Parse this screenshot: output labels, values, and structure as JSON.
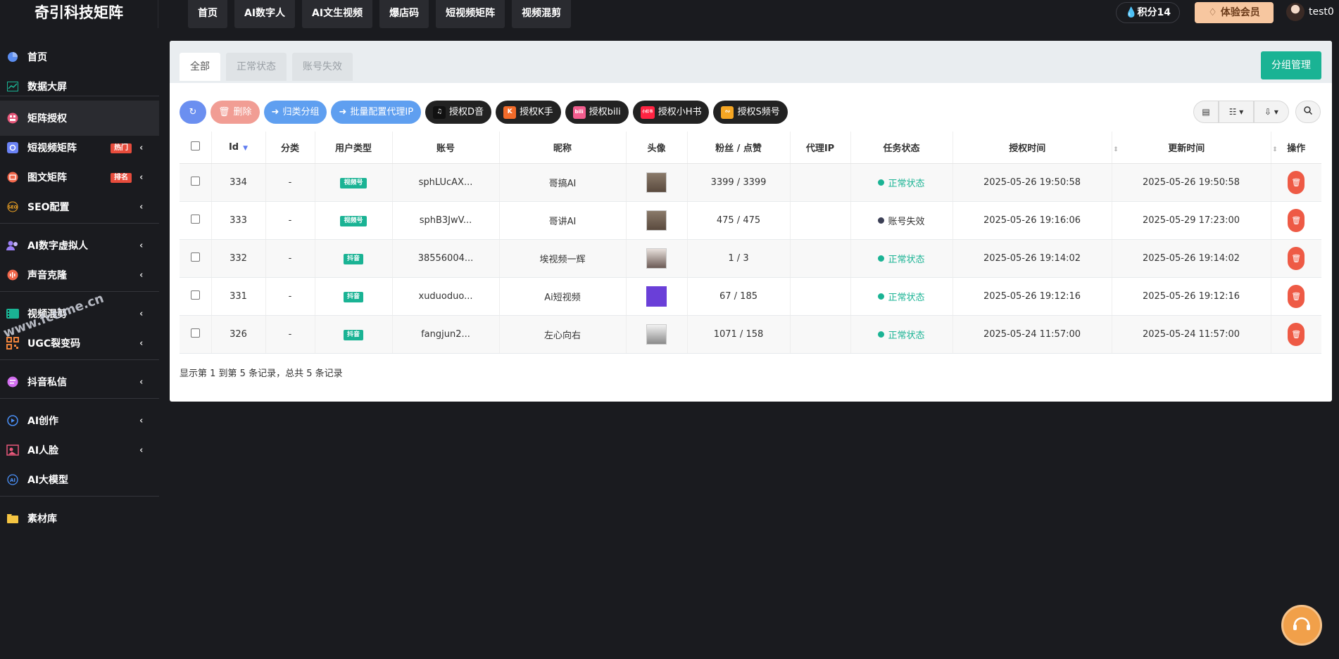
{
  "brand": "奇引科技矩阵",
  "topnav": [
    "首页",
    "AI数字人",
    "AI文生视频",
    "爆店码",
    "短视频矩阵",
    "视频混剪"
  ],
  "points": "积分14",
  "vip_label": "体验会员",
  "username": "test0",
  "sidebar": [
    {
      "label": "首页",
      "icon": "pie-chart-icon"
    },
    {
      "label": "数据大屏",
      "icon": "line-chart-icon"
    },
    {
      "label": "矩阵授权",
      "icon": "matrix-icon",
      "active": true
    },
    {
      "label": "短视频矩阵",
      "icon": "video-matrix-icon",
      "badge": "热门"
    },
    {
      "label": "图文矩阵",
      "icon": "image-text-icon",
      "badge": "排名"
    },
    {
      "label": "SEO配置",
      "icon": "seo-icon"
    },
    {
      "label": "AI数字虚拟人",
      "icon": "users-icon"
    },
    {
      "label": "声音克隆",
      "icon": "audio-icon"
    },
    {
      "label": "视频混剪",
      "icon": "film-icon"
    },
    {
      "label": "UGC裂变码",
      "icon": "qr-code-icon"
    },
    {
      "label": "抖音私信",
      "icon": "message-icon"
    },
    {
      "label": "AI创作",
      "icon": "ai-create-icon"
    },
    {
      "label": "AI人脸",
      "icon": "face-icon"
    },
    {
      "label": "AI大模型",
      "icon": "ai-model-icon"
    },
    {
      "label": "素材库",
      "icon": "folder-icon"
    }
  ],
  "watermark": "www.fctime.cn",
  "tabs": [
    "全部",
    "正常状态",
    "账号失效"
  ],
  "group_manage": "分组管理",
  "toolbar": {
    "delete": "删除",
    "classify": "归类分组",
    "proxy": "批量配置代理IP",
    "douyin": "授权D音",
    "kuaishou": "授权K手",
    "bili": "授权bili",
    "xhs": "授权小H书",
    "shipinhao": "授权S频号",
    "bili_icon_text": "bili",
    "xhs_icon_text": "小红书"
  },
  "table": {
    "headers": [
      "Id",
      "分类",
      "用户类型",
      "账号",
      "昵称",
      "头像",
      "粉丝 / 点赞",
      "代理IP",
      "任务状态",
      "授权时间",
      "更新时间",
      "操作"
    ],
    "rows": [
      {
        "id": "334",
        "category": "-",
        "type": "视频号",
        "account": "sphLUcAX...",
        "nickname": "哥搞AI",
        "fans": "3399 / 3399",
        "proxy": "",
        "status": "正常状态",
        "auth_time": "2025-05-26 19:50:58",
        "update_time": "2025-05-26 19:50:58"
      },
      {
        "id": "333",
        "category": "-",
        "type": "视频号",
        "account": "sphB3JwV...",
        "nickname": "哥讲AI",
        "fans": "475 / 475",
        "proxy": "",
        "status": "账号失效",
        "auth_time": "2025-05-26 19:16:06",
        "update_time": "2025-05-29 17:23:00"
      },
      {
        "id": "332",
        "category": "-",
        "type": "抖音",
        "account": "38556004...",
        "nickname": "埃视频一辉",
        "fans": "1 / 3",
        "proxy": "",
        "status": "正常状态",
        "auth_time": "2025-05-26 19:14:02",
        "update_time": "2025-05-26 19:14:02"
      },
      {
        "id": "331",
        "category": "-",
        "type": "抖音",
        "account": "xuduoduo...",
        "nickname": "Ai短视频",
        "fans": "67 / 185",
        "proxy": "",
        "status": "正常状态",
        "auth_time": "2025-05-26 19:12:16",
        "update_time": "2025-05-26 19:12:16"
      },
      {
        "id": "326",
        "category": "-",
        "type": "抖音",
        "account": "fangjun2...",
        "nickname": "左心向右",
        "fans": "1071 / 158",
        "proxy": "",
        "status": "正常状态",
        "auth_time": "2025-05-24 11:57:00",
        "update_time": "2025-05-24 11:57:00"
      }
    ]
  },
  "footer": "显示第 1 到第 5 条记录，总共 5 条记录",
  "colors": {
    "accent": "#1ab394",
    "danger": "#ee5a45",
    "sidebar_bg": "#1a1b1f",
    "status_ok": "#1ab394",
    "status_bad": "#3b3f55"
  }
}
